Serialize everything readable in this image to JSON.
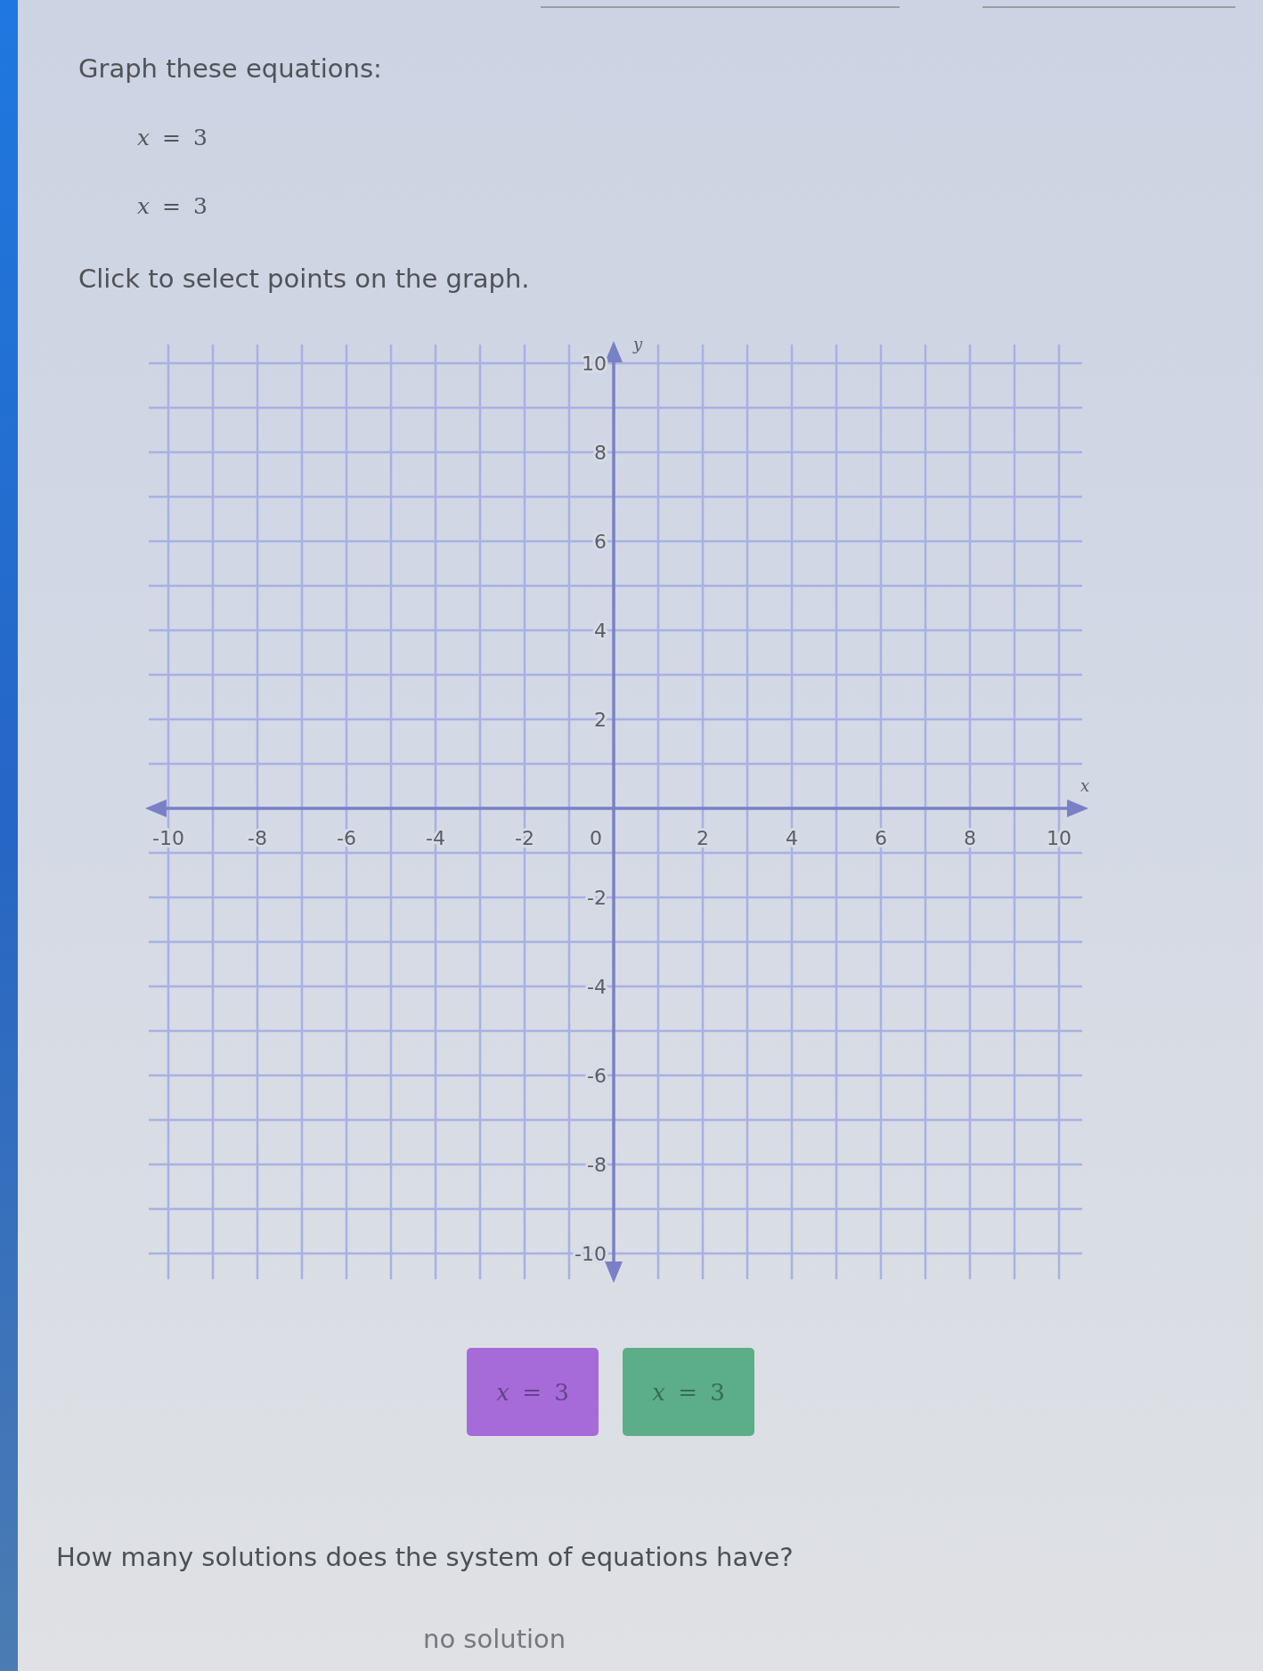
{
  "instructions": "Graph these equations:",
  "equations": [
    "*x* = 3",
    "*x* = 3"
  ],
  "prompt": "Click to select points on the graph.",
  "graph": {
    "x_axis_label": "x",
    "y_axis_label": "y",
    "x_tick_labels": [
      "-10",
      "-8",
      "-6",
      "-4",
      "-2",
      "0",
      "2",
      "4",
      "6",
      "8",
      "10"
    ],
    "y_tick_labels": [
      "10",
      "8",
      "6",
      "4",
      "2",
      "-2",
      "-4",
      "-6",
      "-8",
      "-10"
    ]
  },
  "equation_buttons": [
    {
      "label": "*x* = 3",
      "color": "#a66bd9"
    },
    {
      "label": "*x* = 3",
      "color": "#5bae88"
    }
  ],
  "question": "How many solutions does the system of equations have?",
  "answer_choices": [
    "no solution"
  ]
}
